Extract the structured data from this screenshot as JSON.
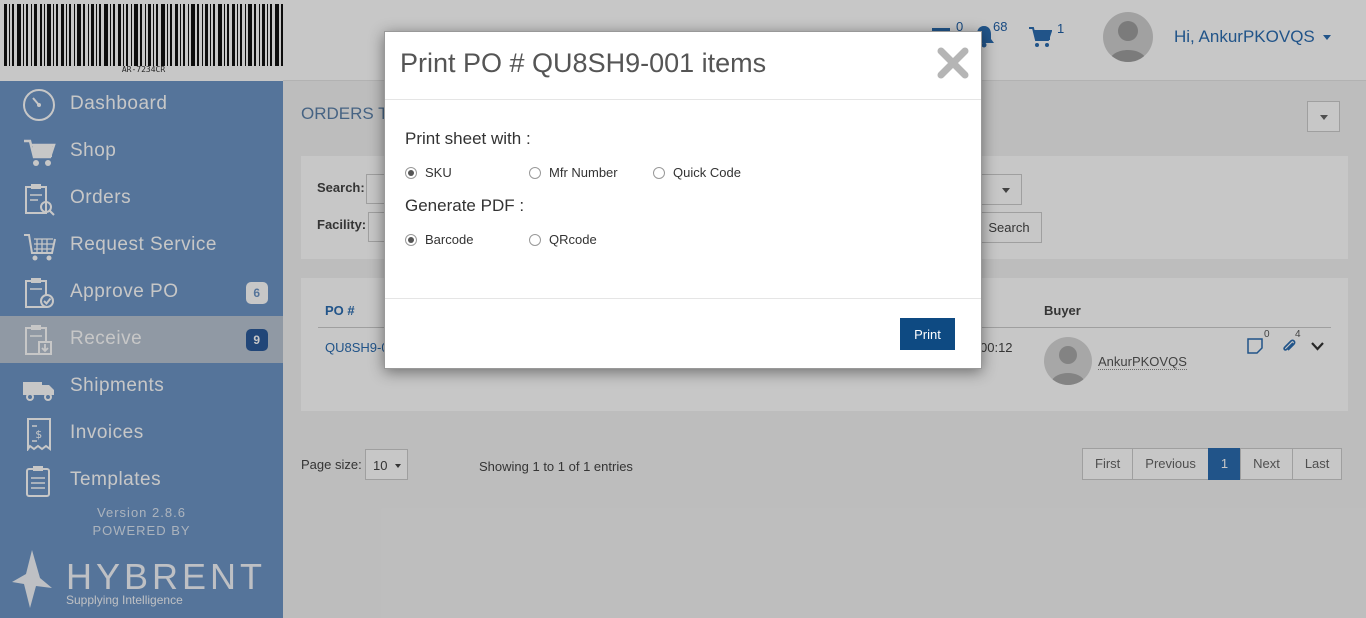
{
  "logo": {
    "barcode_text": "AR-7234CR"
  },
  "sidebar": {
    "items": [
      {
        "label": "Dashboard",
        "icon": "dashboard-icon",
        "badge": ""
      },
      {
        "label": "Shop",
        "icon": "cart-icon",
        "badge": ""
      },
      {
        "label": "Orders",
        "icon": "orders-icon",
        "badge": ""
      },
      {
        "label": "Request Service",
        "icon": "request-service-icon",
        "badge": ""
      },
      {
        "label": "Approve PO",
        "icon": "approve-po-icon",
        "badge": "6"
      },
      {
        "label": "Receive",
        "icon": "receive-icon",
        "badge": "9"
      },
      {
        "label": "Shipments",
        "icon": "truck-icon",
        "badge": ""
      },
      {
        "label": "Invoices",
        "icon": "invoice-icon",
        "badge": ""
      },
      {
        "label": "Templates",
        "icon": "template-icon",
        "badge": ""
      }
    ],
    "active_index": 5,
    "version": "Version 2.8.6",
    "powered_by": "POWERED BY",
    "brand_name": "HYBRENT",
    "brand_tagline": "Supplying Intelligence"
  },
  "header": {
    "messages_count": "0",
    "notifications_count": "68",
    "cart_count": "1",
    "greeting": "Hi, AnkurPKOVQS"
  },
  "main": {
    "title": "ORDERS T",
    "filters": {
      "search_label": "Search:",
      "facility_label": "Facility:",
      "search_button": "Search"
    },
    "table": {
      "headers": {
        "po": "PO #",
        "buyer": "Buyer"
      },
      "row": {
        "po": "QU8SH9-0",
        "time": "00:12",
        "buyer": "AnkurPKOVQS",
        "notes_count": "0",
        "attachments_count": "4"
      }
    },
    "page_size_label": "Page size:",
    "page_size_value": "10",
    "entries_text": "Showing 1 to 1 of 1 entries",
    "pagination": [
      "First",
      "Previous",
      "1",
      "Next",
      "Last"
    ]
  },
  "modal": {
    "title": "Print PO # QU8SH9-001 items",
    "print_with_label": "Print sheet with :",
    "print_with_options": [
      "SKU",
      "Mfr Number",
      "Quick Code"
    ],
    "print_with_selected": "SKU",
    "generate_label": "Generate PDF :",
    "generate_options": [
      "Barcode",
      "QRcode"
    ],
    "generate_selected": "Barcode",
    "print_button": "Print"
  },
  "colors": {
    "sidebar": "#6d95c6",
    "accent": "#2b6cb0",
    "print_button": "#0e4a82"
  }
}
